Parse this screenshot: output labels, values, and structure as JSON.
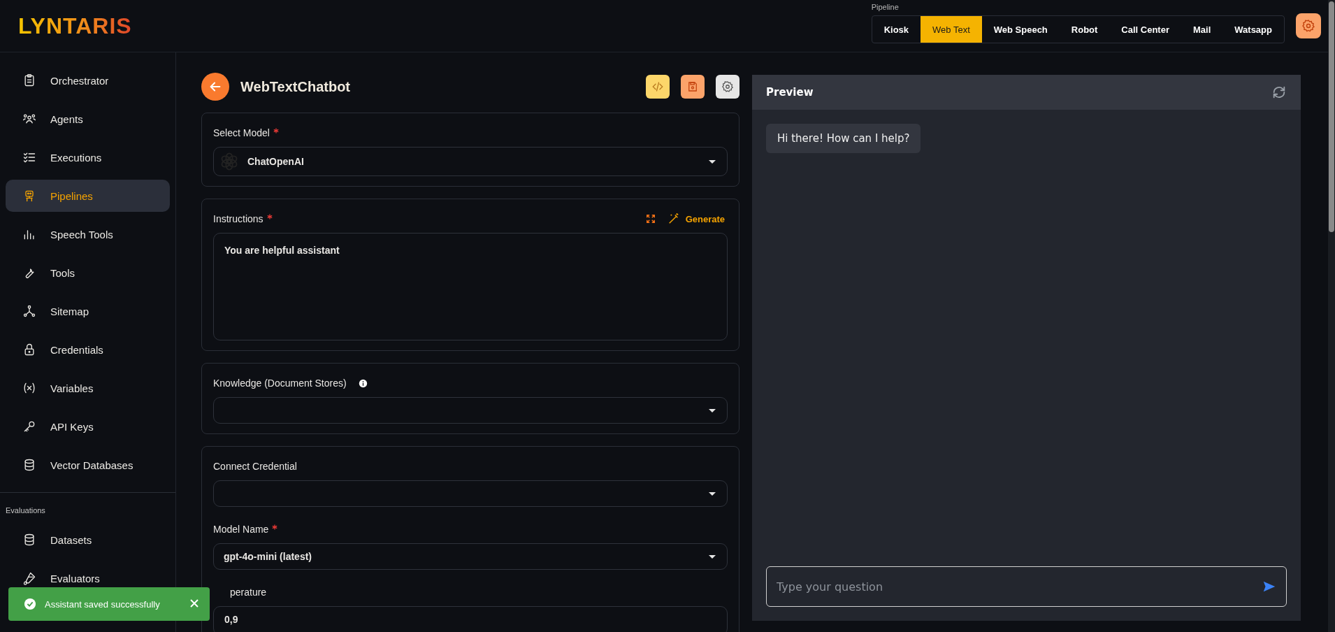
{
  "logo": "LYNTARIS",
  "pipeline": {
    "label": "Pipeline",
    "tabs": [
      {
        "label": "Kiosk",
        "selected": false
      },
      {
        "label": "Web Text",
        "selected": true
      },
      {
        "label": "Web Speech",
        "selected": false
      },
      {
        "label": "Robot",
        "selected": false
      },
      {
        "label": "Call Center",
        "selected": false
      },
      {
        "label": "Mail",
        "selected": false
      },
      {
        "label": "Watsapp",
        "selected": false
      }
    ]
  },
  "sidebar": {
    "items": [
      {
        "label": "Orchestrator",
        "selected": false
      },
      {
        "label": "Agents",
        "selected": false
      },
      {
        "label": "Executions",
        "selected": false
      },
      {
        "label": "Pipelines",
        "selected": true
      },
      {
        "label": "Speech Tools",
        "selected": false
      },
      {
        "label": "Tools",
        "selected": false
      },
      {
        "label": "Sitemap",
        "selected": false
      },
      {
        "label": "Credentials",
        "selected": false
      },
      {
        "label": "Variables",
        "selected": false
      },
      {
        "label": "API Keys",
        "selected": false
      },
      {
        "label": "Vector Databases",
        "selected": false
      }
    ],
    "section": {
      "title": "Evaluations",
      "items": [
        {
          "label": "Datasets",
          "selected": false
        },
        {
          "label": "Evaluators",
          "selected": false
        }
      ]
    }
  },
  "editor": {
    "title": "WebTextChatbot",
    "cards": [
      {
        "fields": [
          {
            "kind": "select",
            "label": "Select Model",
            "required": true,
            "logo": true,
            "value": "ChatOpenAI"
          }
        ]
      },
      {
        "fields": [
          {
            "kind": "textarea",
            "label": "Instructions",
            "required": true,
            "generate": "Generate",
            "value": "You are helpful assistant"
          }
        ]
      },
      {
        "fields": [
          {
            "kind": "select",
            "label": "Knowledge (Document Stores)",
            "required": false,
            "info": true
          }
        ]
      },
      {
        "fields": [
          {
            "kind": "select",
            "label": "Connect Credential",
            "required": false
          },
          {
            "kind": "select",
            "label": "Model Name",
            "required": true,
            "value": "gpt-4o-mini (latest)"
          },
          {
            "kind": "number",
            "label": "perature",
            "required": false,
            "value": "0,9"
          }
        ]
      }
    ]
  },
  "preview": {
    "title": "Preview",
    "messages": [
      {
        "text": "Hi there! How can I help?"
      }
    ],
    "input": {
      "placeholder": "Type your question"
    }
  },
  "toast": {
    "kind": "success",
    "text": "Assistant saved successfully"
  }
}
